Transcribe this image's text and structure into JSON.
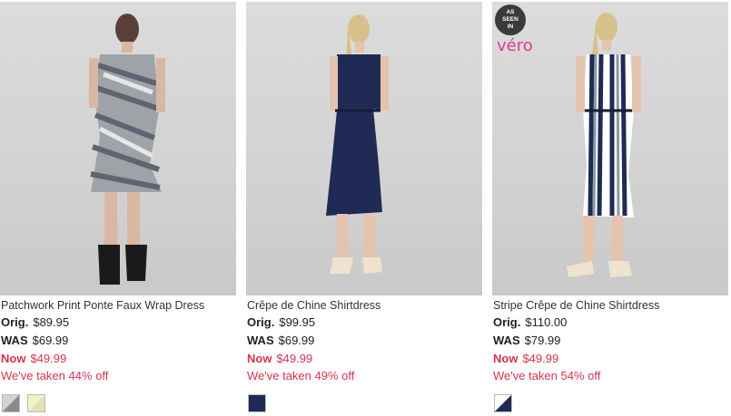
{
  "products": [
    {
      "name": "Patchwork Print Ponte Faux Wrap Dress",
      "orig_label": "Orig.",
      "orig_price": "$89.95",
      "was_label": "WAS",
      "was_price": "$69.99",
      "now_label": "Now",
      "now_price": "$49.99",
      "discount_text": "We've taken 44% off",
      "swatches": [
        {
          "name": "grey-patchwork",
          "colors": [
            "#8e8e8e",
            "#cfcfcf"
          ]
        },
        {
          "name": "yellow-patchwork",
          "colors": [
            "#f3f0c9",
            "#e8e4b8"
          ]
        }
      ]
    },
    {
      "name": "Crêpe de Chine Shirtdress",
      "orig_label": "Orig.",
      "orig_price": "$99.95",
      "was_label": "WAS",
      "was_price": "$69.99",
      "now_label": "Now",
      "now_price": "$49.99",
      "discount_text": "We've taken 49% off",
      "swatches": [
        {
          "name": "navy",
          "colors": [
            "#1f2b54",
            "#1f2b54"
          ]
        }
      ]
    },
    {
      "name": "Stripe Crêpe de Chine Shirtdress",
      "orig_label": "Orig.",
      "orig_price": "$110.00",
      "was_label": "WAS",
      "was_price": "$79.99",
      "now_label": "Now",
      "now_price": "$49.99",
      "discount_text": "We've taken 54% off",
      "swatches": [
        {
          "name": "navy-white-stripe",
          "colors": [
            "#1f2b54",
            "#ffffff"
          ]
        }
      ],
      "badge_lines": [
        "AS",
        "SEEN",
        "IN"
      ],
      "badge_brand": "véro"
    }
  ],
  "colors": {
    "sale_red": "#d6334f",
    "badge_bg": "#3a3a3a",
    "brand_pink": "#e0399b"
  }
}
